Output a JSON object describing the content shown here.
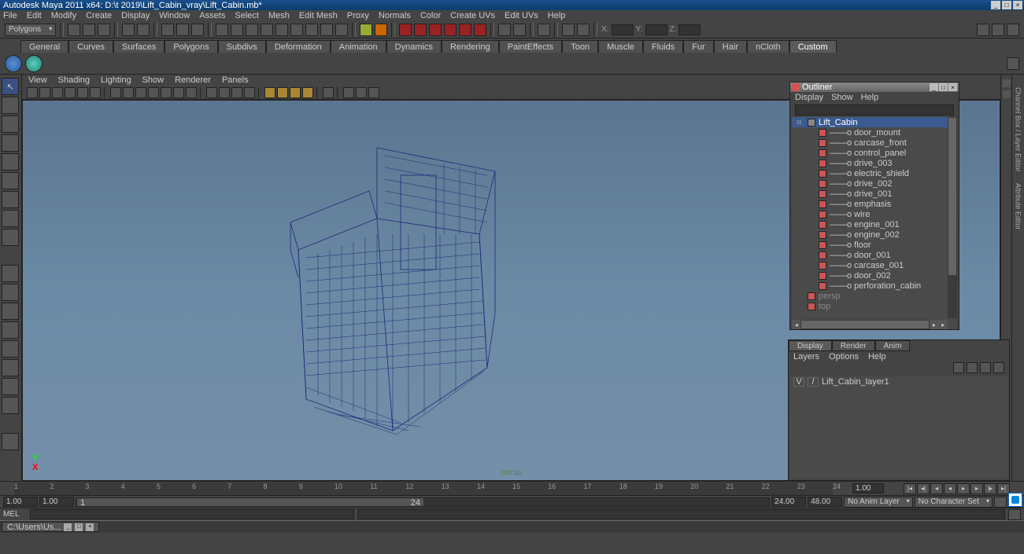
{
  "titlebar": {
    "title": "Autodesk Maya 2011 x64: D:\\t 2019\\Lift_Cabin_vray\\Lift_Cabin.mb*"
  },
  "menubar": [
    "File",
    "Edit",
    "Modify",
    "Create",
    "Display",
    "Window",
    "Assets",
    "Select",
    "Mesh",
    "Edit Mesh",
    "Proxy",
    "Normals",
    "Color",
    "Create UVs",
    "Edit UVs",
    "Help"
  ],
  "module_combo": "Polygons",
  "coord_labels": {
    "x": "X:",
    "y": "Y:",
    "z": "Z:"
  },
  "shelf_tabs": [
    "General",
    "Curves",
    "Surfaces",
    "Polygons",
    "Subdivs",
    "Deformation",
    "Animation",
    "Dynamics",
    "Rendering",
    "PaintEffects",
    "Toon",
    "Muscle",
    "Fluids",
    "Fur",
    "Hair",
    "nCloth",
    "Custom"
  ],
  "active_shelf_tab": "Custom",
  "viewport_menu": [
    "View",
    "Shading",
    "Lighting",
    "Show",
    "Renderer",
    "Panels"
  ],
  "persp_label": "persp",
  "axis": {
    "y": "Y",
    "x": "X"
  },
  "outliner": {
    "title": "Outliner",
    "menu": [
      "Display",
      "Show",
      "Help"
    ],
    "items": [
      {
        "label": "Lift_Cabin",
        "sel": true,
        "indent": 0,
        "icon": "mesh",
        "expand": "⊟"
      },
      {
        "label": "——o door_mount",
        "indent": 1
      },
      {
        "label": "——o carcase_front",
        "indent": 1
      },
      {
        "label": "——o control_panel",
        "indent": 1
      },
      {
        "label": "——o drive_003",
        "indent": 1
      },
      {
        "label": "——o electric_shield",
        "indent": 1
      },
      {
        "label": "——o drive_002",
        "indent": 1
      },
      {
        "label": "——o drive_001",
        "indent": 1
      },
      {
        "label": "——o emphasis",
        "indent": 1
      },
      {
        "label": "——o wire",
        "indent": 1
      },
      {
        "label": "——o engine_001",
        "indent": 1
      },
      {
        "label": "——o engine_002",
        "indent": 1
      },
      {
        "label": "——o floor",
        "indent": 1
      },
      {
        "label": "——o door_001",
        "indent": 1
      },
      {
        "label": "——o carcase_001",
        "indent": 1
      },
      {
        "label": "——o door_002",
        "indent": 1
      },
      {
        "label": "——o perforation_cabin",
        "indent": 1
      },
      {
        "label": "persp",
        "indent": 0,
        "faded": true
      },
      {
        "label": "top",
        "indent": 0,
        "faded": true
      }
    ]
  },
  "layers": {
    "tabs": [
      "Display",
      "Render",
      "Anim"
    ],
    "active_tab": "Display",
    "menu": [
      "Layers",
      "Options",
      "Help"
    ],
    "rows": [
      {
        "vis": "V",
        "type": "/",
        "name": "Lift_Cabin_layer1"
      }
    ]
  },
  "timeline": {
    "ticks": [
      "1",
      "2",
      "3",
      "4",
      "5",
      "6",
      "7",
      "8",
      "9",
      "10",
      "11",
      "12",
      "13",
      "14",
      "15",
      "16",
      "17",
      "18",
      "19",
      "20",
      "21",
      "22",
      "23",
      "24"
    ],
    "current_box": "1.00"
  },
  "range": {
    "start_all": "1.00",
    "start": "1.00",
    "cur": "1",
    "cur_hi": "24",
    "end": "24.00",
    "end_all": "48.00",
    "anim_layer": "No Anim Layer",
    "char_set": "No Character Set"
  },
  "cmd": {
    "lang": "MEL"
  },
  "taskbar": {
    "item": "C:\\Users\\Us..."
  },
  "side_labels": {
    "channel": "Channel Box / Layer Editor",
    "attr": "Attribute Editor"
  }
}
